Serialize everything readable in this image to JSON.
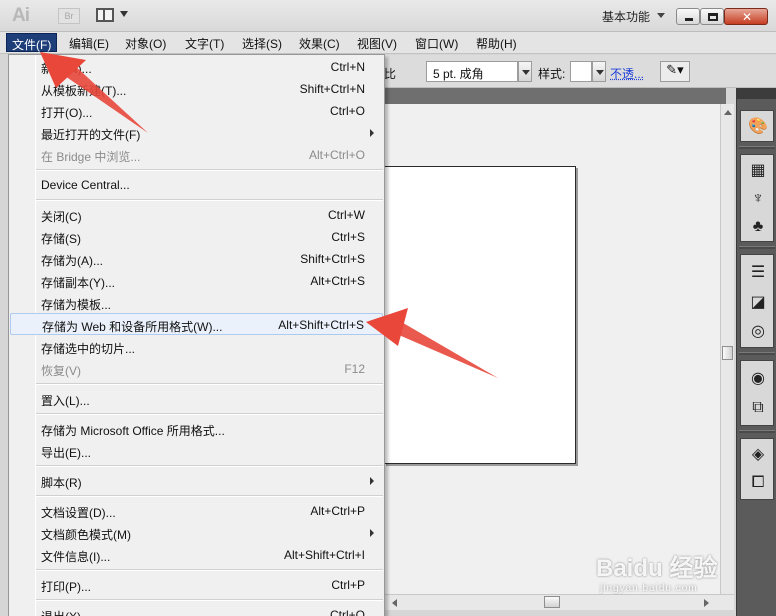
{
  "app": {
    "logo": "Ai",
    "bridge": "Br",
    "workspace": "基本功能"
  },
  "menubar": {
    "items": [
      "文件(F)",
      "编辑(E)",
      "对象(O)",
      "文字(T)",
      "选择(S)",
      "效果(C)",
      "视图(V)",
      "窗口(W)",
      "帮助(H)"
    ]
  },
  "controlbar": {
    "ratio": "比",
    "stroke_profile": "5 pt. 成角",
    "style_label": "样式:",
    "opacity_link": "不透..."
  },
  "file_menu": {
    "items": [
      {
        "label": "新建(N)...",
        "shortcut": "Ctrl+N",
        "disabled": false
      },
      {
        "label": "从模板新建(T)...",
        "shortcut": "Shift+Ctrl+N",
        "disabled": false
      },
      {
        "label": "打开(O)...",
        "shortcut": "Ctrl+O",
        "disabled": false
      },
      {
        "label": "最近打开的文件(F)",
        "shortcut": "",
        "disabled": false,
        "submenu": true
      },
      {
        "label": "在 Bridge 中浏览...",
        "shortcut": "Alt+Ctrl+O",
        "disabled": true
      },
      {
        "label": "Device Central...",
        "shortcut": "",
        "disabled": false
      },
      {
        "label": "关闭(C)",
        "shortcut": "Ctrl+W",
        "disabled": false
      },
      {
        "label": "存储(S)",
        "shortcut": "Ctrl+S",
        "disabled": false
      },
      {
        "label": "存储为(A)...",
        "shortcut": "Shift+Ctrl+S",
        "disabled": false
      },
      {
        "label": "存储副本(Y)...",
        "shortcut": "Alt+Ctrl+S",
        "disabled": false
      },
      {
        "label": "存储为模板...",
        "shortcut": "",
        "disabled": false
      },
      {
        "label": "存储为 Web 和设备所用格式(W)...",
        "shortcut": "Alt+Shift+Ctrl+S",
        "disabled": false,
        "highlighted": true
      },
      {
        "label": "存储选中的切片...",
        "shortcut": "",
        "disabled": false
      },
      {
        "label": "恢复(V)",
        "shortcut": "F12",
        "disabled": true
      },
      {
        "label": "置入(L)...",
        "shortcut": "",
        "disabled": false
      },
      {
        "label": "存储为 Microsoft Office 所用格式...",
        "shortcut": "",
        "disabled": false
      },
      {
        "label": "导出(E)...",
        "shortcut": "",
        "disabled": false
      },
      {
        "label": "脚本(R)",
        "shortcut": "",
        "disabled": false,
        "submenu": true
      },
      {
        "label": "文档设置(D)...",
        "shortcut": "Alt+Ctrl+P",
        "disabled": false
      },
      {
        "label": "文档颜色模式(M)",
        "shortcut": "",
        "disabled": false,
        "submenu": true
      },
      {
        "label": "文件信息(I)...",
        "shortcut": "Alt+Shift+Ctrl+I",
        "disabled": false
      },
      {
        "label": "打印(P)...",
        "shortcut": "Ctrl+P",
        "disabled": false
      },
      {
        "label": "退出(X)",
        "shortcut": "Ctrl+Q",
        "disabled": false
      }
    ]
  },
  "dock_icons": [
    "color-guide-icon",
    "swatches-icon",
    "brushes-icon",
    "symbols-icon",
    "stroke-icon",
    "gradient-icon",
    "transparency-icon",
    "appearance-icon",
    "graphic-styles-icon",
    "layers-icon",
    "artboards-icon"
  ],
  "watermark": {
    "brand": "Baidu 经验",
    "url": "jingyan.baidu.com"
  },
  "colors": {
    "menu_active": "#1e3e7a",
    "highlight_row": "#eaf1fb",
    "annotation_arrow": "#e8473a",
    "dock": "#5b5b5b"
  }
}
